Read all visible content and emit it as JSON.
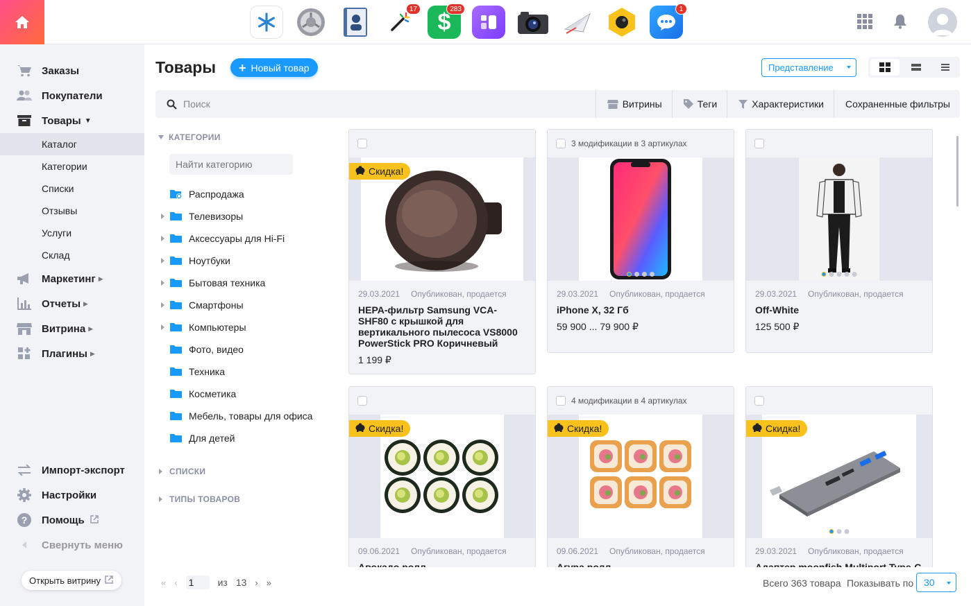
{
  "topbar": {
    "apps": [
      {
        "name": "snowflake-app",
        "badge": ""
      },
      {
        "name": "settings-gear-app",
        "badge": ""
      },
      {
        "name": "contacts-book-app",
        "badge": ""
      },
      {
        "name": "magic-wand-app",
        "badge": "17"
      },
      {
        "name": "shop-dollar-app",
        "badge": "283"
      },
      {
        "name": "purple-app",
        "badge": ""
      },
      {
        "name": "camera-app",
        "badge": ""
      },
      {
        "name": "mailer-plane-app",
        "badge": ""
      },
      {
        "name": "hexagon-app",
        "badge": ""
      },
      {
        "name": "chat-app",
        "badge": "1"
      }
    ]
  },
  "sidebar": {
    "main": [
      {
        "label": "Заказы",
        "icon": "cart-icon"
      },
      {
        "label": "Покупатели",
        "icon": "users-icon"
      },
      {
        "label": "Товары",
        "icon": "box-icon",
        "expanded": true
      }
    ],
    "sub": [
      {
        "label": "Каталог",
        "active": true
      },
      {
        "label": "Категории"
      },
      {
        "label": "Списки"
      },
      {
        "label": "Отзывы"
      },
      {
        "label": "Услуги"
      },
      {
        "label": "Склад"
      }
    ],
    "more": [
      {
        "label": "Маркетинг",
        "icon": "megaphone-icon"
      },
      {
        "label": "Отчеты",
        "icon": "chart-icon"
      },
      {
        "label": "Витрина",
        "icon": "storefront-icon"
      },
      {
        "label": "Плагины",
        "icon": "plugins-icon"
      }
    ],
    "bottom": [
      {
        "label": "Импорт-экспорт",
        "icon": "import-export-icon"
      },
      {
        "label": "Настройки",
        "icon": "settings-icon"
      },
      {
        "label": "Помощь",
        "icon": "help-icon"
      },
      {
        "label": "Свернуть меню",
        "icon": "collapse-icon"
      }
    ],
    "open_store": "Открыть витрину"
  },
  "header": {
    "title": "Товары",
    "new_button": "Новый товар",
    "view_select": "Представление"
  },
  "search": {
    "placeholder": "Поиск",
    "filters": [
      "Витрины",
      "Теги",
      "Характеристики",
      "Сохраненные фильтры"
    ]
  },
  "categories": {
    "heading": "КАТЕГОРИИ",
    "search_placeholder": "Найти категорию",
    "items": [
      {
        "label": "Распродажа",
        "expandable": false,
        "dynamic": true
      },
      {
        "label": "Телевизоры",
        "expandable": true
      },
      {
        "label": "Аксессуары для Hi-Fi",
        "expandable": true
      },
      {
        "label": "Ноутбуки",
        "expandable": true
      },
      {
        "label": "Бытовая техника",
        "expandable": true
      },
      {
        "label": "Смартфоны",
        "expandable": true
      },
      {
        "label": "Компьютеры",
        "expandable": true
      },
      {
        "label": "Фото, видео",
        "expandable": false
      },
      {
        "label": "Техника",
        "expandable": false
      },
      {
        "label": "Косметика",
        "expandable": false
      },
      {
        "label": "Мебель, товары для офиса",
        "expandable": false
      },
      {
        "label": "Для детей",
        "expandable": false
      }
    ],
    "lists_heading": "СПИСКИ",
    "types_heading": "ТИПЫ ТОВАРОВ"
  },
  "products": [
    {
      "mods": "",
      "sale": "Скидка!",
      "date": "29.03.2021",
      "status": "Опубликован, продается",
      "name": "HEPA-фильтр Samsung VCA-SHF80 с крышкой для вертикального пылесоса VS8000 PowerStick PRO Коричневый",
      "price": "1 199 ₽",
      "image": "filter-image"
    },
    {
      "mods": "3 модификации в 3 артикулах",
      "sale": "",
      "date": "29.03.2021",
      "status": "Опубликован, продается",
      "name": "iPhone X, 32 Гб",
      "price": "59 900 ... 79 900 ₽",
      "image": "phone-image"
    },
    {
      "mods": "",
      "sale": "",
      "date": "29.03.2021",
      "status": "Опубликован, продается",
      "name": "Off-White",
      "price": "125 500 ₽",
      "image": "fashion-image"
    },
    {
      "mods": "",
      "sale": "Скидка!",
      "date": "09.06.2021",
      "status": "Опубликован, продается",
      "name": "Авокадо ролл",
      "price": "",
      "image": "sushi-avocado-image"
    },
    {
      "mods": "4 модификации в 4 артикулах",
      "sale": "Скидка!",
      "date": "09.06.2021",
      "status": "Опубликован, продается",
      "name": "Агура ролл",
      "price": "",
      "image": "sushi-agura-image"
    },
    {
      "mods": "",
      "sale": "Скидка!",
      "date": "29.03.2021",
      "status": "Опубликован, продается",
      "name": "Адаптер moonfish Multiport Type-C",
      "price": "",
      "image": "adapter-image"
    }
  ],
  "pagination": {
    "current": "1",
    "of_label": "из",
    "total_pages": "13",
    "total_label": "Всего 363 товара",
    "per_page_label": "Показывать по",
    "per_page": "30"
  },
  "colors": {
    "accent": "#1a9afe",
    "sale": "#f8c11c",
    "home_gradient_start": "#ff4f8b",
    "home_gradient_end": "#ff6a3d"
  }
}
